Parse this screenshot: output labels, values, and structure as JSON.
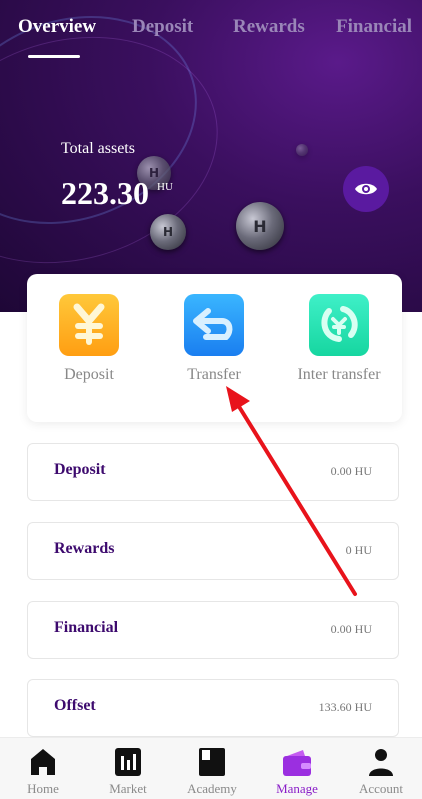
{
  "tabs": [
    {
      "label": "Overview",
      "active": true
    },
    {
      "label": "Deposit",
      "active": false
    },
    {
      "label": "Rewards",
      "active": false
    },
    {
      "label": "Financial",
      "active": false
    }
  ],
  "assets": {
    "label": "Total assets",
    "value": "223.30",
    "unit": "HU"
  },
  "actions": [
    {
      "label": "Deposit",
      "icon": "yuan-icon"
    },
    {
      "label": "Transfer",
      "icon": "transfer-arrow-icon"
    },
    {
      "label": "Inter transfer",
      "icon": "exchange-icon"
    }
  ],
  "rows": [
    {
      "name": "Deposit",
      "value": "0.00 HU"
    },
    {
      "name": "Rewards",
      "value": "0 HU"
    },
    {
      "name": "Financial",
      "value": "0.00 HU"
    },
    {
      "name": "Offset",
      "value": "133.60 HU"
    }
  ],
  "nav": [
    {
      "label": "Home",
      "icon": "home-icon",
      "active": false
    },
    {
      "label": "Market",
      "icon": "chart-icon",
      "active": false
    },
    {
      "label": "Academy",
      "icon": "book-icon",
      "active": false
    },
    {
      "label": "Manage",
      "icon": "wallet-icon",
      "active": true
    },
    {
      "label": "Account",
      "icon": "user-icon",
      "active": false
    }
  ],
  "colors": {
    "accent": "#8a1ec8",
    "row_title": "#3d0a6e",
    "annotation": "#e8131b"
  }
}
